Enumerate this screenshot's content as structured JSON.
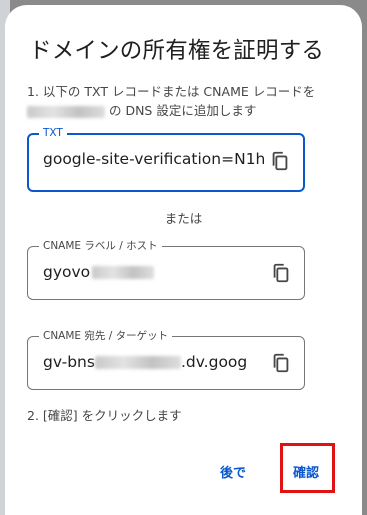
{
  "dialog": {
    "title": "ドメインの所有権を証明する",
    "step1": {
      "line1": "1. 以下の TXT レコードまたは CNAME レコードを",
      "line2_suffix": " の DNS 設定に追加します"
    },
    "txt_field": {
      "label": "TXT",
      "value": "google-site-verification=N1h",
      "copy_icon": "copy-icon"
    },
    "separator": "または",
    "cname_label_field": {
      "label": "CNAME ラベル / ホスト",
      "value_prefix": "gyovo",
      "copy_icon": "copy-icon"
    },
    "cname_dest_field": {
      "label": "CNAME 宛先 / ターゲット",
      "value_prefix": "gv-bns",
      "value_suffix": ".dv.goog",
      "copy_icon": "copy-icon"
    },
    "step2": "2. [確認] をクリックします",
    "buttons": {
      "later": "後で",
      "confirm": "確認"
    }
  },
  "colors": {
    "accent": "#0b57d0",
    "highlight": "#e01212",
    "text": "#1f1f1f",
    "secondary_text": "#444746"
  }
}
